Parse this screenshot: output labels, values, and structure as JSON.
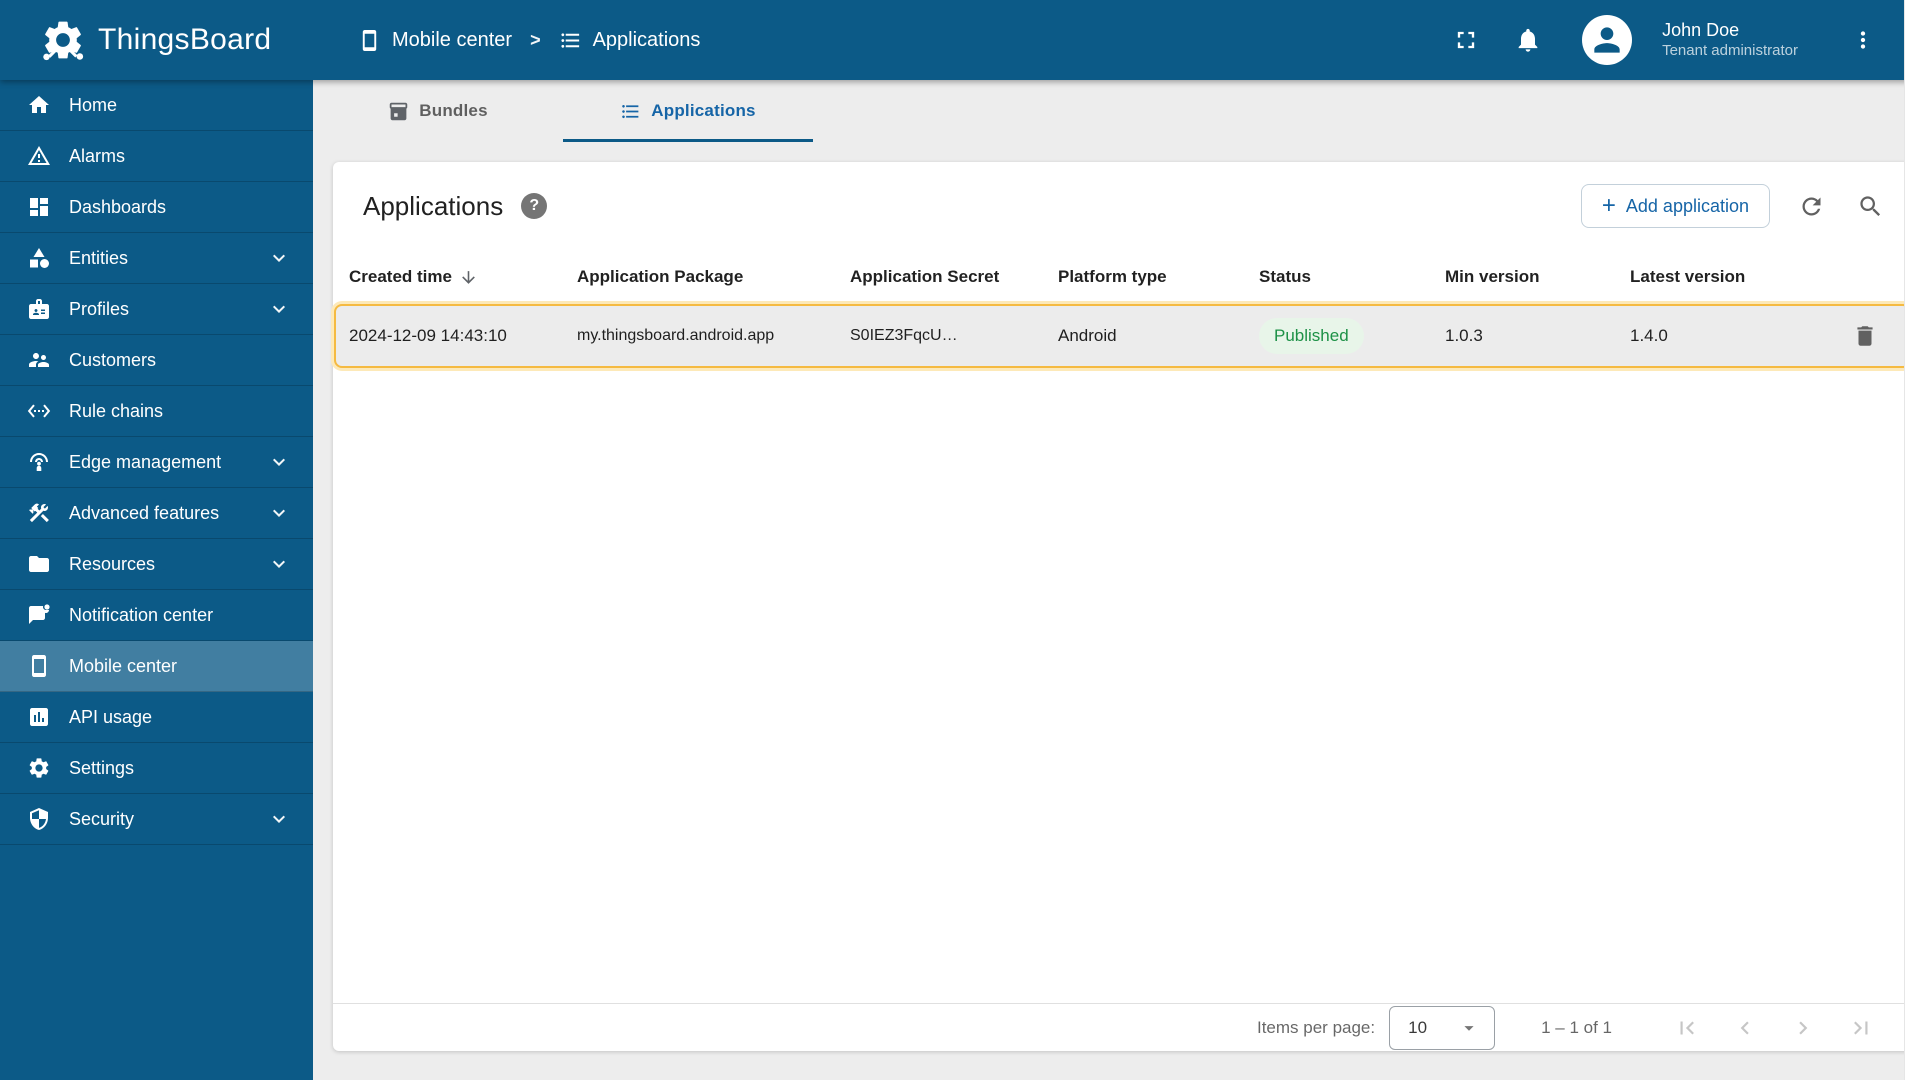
{
  "colors": {
    "header_bg": "#0c5a87",
    "accent_blue": "#1665a7",
    "row_highlight_border": "#f5ba41",
    "published_text": "#1d9146",
    "published_bg": "#e8f5e9"
  },
  "header": {
    "brand": "ThingsBoard",
    "breadcrumb": {
      "section": "Mobile center",
      "separator": ">",
      "page": "Applications"
    },
    "user": {
      "name": "John Doe",
      "role": "Tenant administrator"
    }
  },
  "sidebar": {
    "items": [
      {
        "label": "Home",
        "icon": "home-icon",
        "expandable": false,
        "active": false
      },
      {
        "label": "Alarms",
        "icon": "warning-icon",
        "expandable": false,
        "active": false
      },
      {
        "label": "Dashboards",
        "icon": "dashboard-icon",
        "expandable": false,
        "active": false
      },
      {
        "label": "Entities",
        "icon": "category-icon",
        "expandable": true,
        "active": false
      },
      {
        "label": "Profiles",
        "icon": "badge-icon",
        "expandable": true,
        "active": false
      },
      {
        "label": "Customers",
        "icon": "people-icon",
        "expandable": false,
        "active": false
      },
      {
        "label": "Rule chains",
        "icon": "ethernet-icon",
        "expandable": false,
        "active": false
      },
      {
        "label": "Edge management",
        "icon": "antenna-icon",
        "expandable": true,
        "active": false
      },
      {
        "label": "Advanced features",
        "icon": "construction-icon",
        "expandable": true,
        "active": false
      },
      {
        "label": "Resources",
        "icon": "folder-icon",
        "expandable": true,
        "active": false
      },
      {
        "label": "Notification center",
        "icon": "notification-bubble-icon",
        "expandable": false,
        "active": false
      },
      {
        "label": "Mobile center",
        "icon": "smartphone-icon",
        "expandable": false,
        "active": true
      },
      {
        "label": "API usage",
        "icon": "chart-icon",
        "expandable": false,
        "active": false
      },
      {
        "label": "Settings",
        "icon": "gear-icon",
        "expandable": false,
        "active": false
      },
      {
        "label": "Security",
        "icon": "shield-icon",
        "expandable": true,
        "active": false
      }
    ]
  },
  "tabs": {
    "bundles": "Bundles",
    "applications": "Applications"
  },
  "panel": {
    "title": "Applications",
    "help_glyph": "?",
    "add_button_plus": "+",
    "add_button_label": "Add application"
  },
  "table": {
    "columns": [
      "Created time",
      "Application Package",
      "Application Secret",
      "Platform type",
      "Status",
      "Min version",
      "Latest version"
    ],
    "sorted_column": "Created time",
    "sort_direction": "desc",
    "rows": [
      {
        "created_time": "2024-12-09 14:43:10",
        "package": "my.thingsboard.android.app",
        "secret": "S0IEZ3FqcU…",
        "platform": "Android",
        "status": "Published",
        "min_version": "1.0.3",
        "latest_version": "1.4.0"
      }
    ]
  },
  "pagination": {
    "items_per_page_label": "Items per page:",
    "page_size": "10",
    "range_label": "1 – 1 of 1"
  }
}
